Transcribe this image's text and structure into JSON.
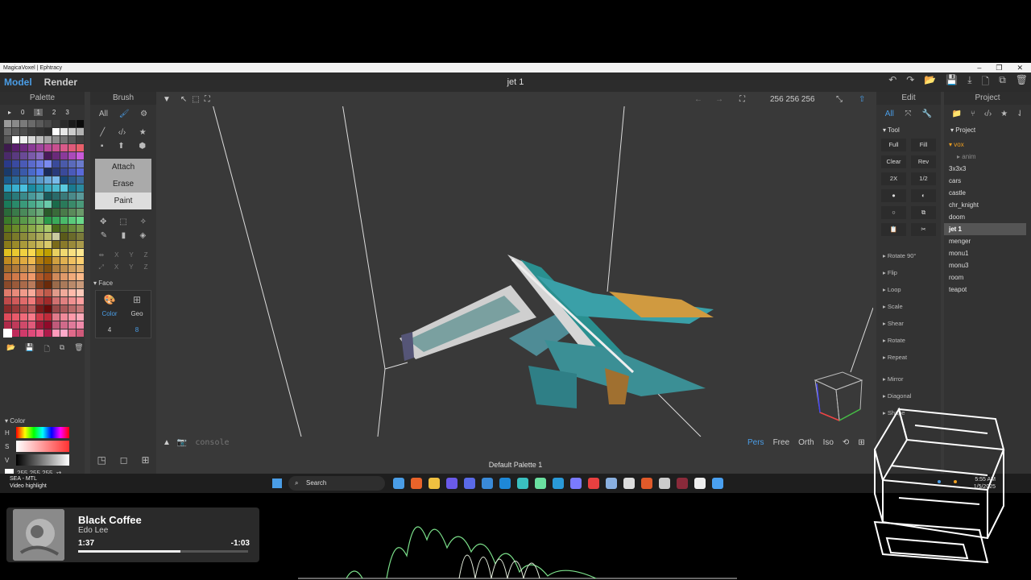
{
  "window": {
    "title": "MagicaVoxel | Ephtracy",
    "minimize_glyph": "–",
    "restore_glyph": "❐",
    "close_glyph": "✕"
  },
  "topbar": {
    "model_tab": "Model",
    "render_tab": "Render",
    "document_title": "jet 1",
    "actions": [
      "↶",
      "↷",
      "📂",
      "💾",
      "⤓",
      "🗋",
      "⧉",
      "🗑"
    ]
  },
  "palette": {
    "header": "Palette",
    "tabs": [
      "▸",
      "0",
      "1",
      "2",
      "3"
    ],
    "selected_tab": "1",
    "colors": [
      "#9a9a9a",
      "#8a8a8a",
      "#7a7a7a",
      "#6a6a6a",
      "#5a5a5a",
      "#4a4a4a",
      "#3a3a3a",
      "#2a2a2a",
      "#1a1a1a",
      "#0a0a0a",
      "#6a6a6a",
      "#5a5a5a",
      "#4c4c4c",
      "#3c3c3c",
      "#333333",
      "#2b2b2b",
      "#ffffff",
      "#e6e6e6",
      "#cccccc",
      "#b3b3b3",
      "#555555",
      "#ffffff",
      "#f0f0f0",
      "#d9d9d9",
      "#bfbfbf",
      "#a6a6a6",
      "#8c8c8c",
      "#737373",
      "#595959",
      "#404040",
      "#3d1a4d",
      "#5a1f6e",
      "#6e2a80",
      "#8a3a96",
      "#a0459e",
      "#b84a9a",
      "#c85090",
      "#d85a8a",
      "#e05a7a",
      "#e8606a",
      "#4a2a6a",
      "#5a3a80",
      "#6a4a96",
      "#7a5aaa",
      "#8a6abf",
      "#4a1a5a",
      "#6a2a7a",
      "#8a3a9a",
      "#aa4aba",
      "#ca5ada",
      "#2a3a8a",
      "#3a4aa0",
      "#4a5ab6",
      "#5a6acc",
      "#6a7ae0",
      "#7a8af0",
      "#3a4a9a",
      "#4a5aaa",
      "#5a6abb",
      "#6a7acc",
      "#1a3a6a",
      "#2a4a8a",
      "#3a5aaa",
      "#4a6aca",
      "#5a7aea",
      "#1a2a5a",
      "#2a3a7a",
      "#3a4a9a",
      "#4a5aba",
      "#5a6ada",
      "#1a5a8a",
      "#2a6a9a",
      "#3a7aaa",
      "#4a8aba",
      "#5a9aca",
      "#6aaada",
      "#7abaea",
      "#1a4a7a",
      "#2a5a8a",
      "#3a6a9a",
      "#2aa0c0",
      "#3ab0d0",
      "#4ac0e0",
      "#1a8aa0",
      "#2a9ab0",
      "#3aaac0",
      "#4abad0",
      "#5acae0",
      "#1a7a90",
      "#2a8aa0",
      "#1a6a6a",
      "#2a7a7a",
      "#3a8a8a",
      "#4a9a9a",
      "#5aaaaa",
      "#1a5a5a",
      "#2a6a6a",
      "#3a7a7a",
      "#4a8a8a",
      "#5a9a9a",
      "#1a7a5a",
      "#2a8a6a",
      "#3a9a7a",
      "#4aaa8a",
      "#5aba9a",
      "#6acaaa",
      "#1a6a4a",
      "#2a7a5a",
      "#3a8a6a",
      "#4a9a7a",
      "#2a6a3a",
      "#3a7a4a",
      "#4a8a5a",
      "#5a9a6a",
      "#6aaa7a",
      "#2a5a2a",
      "#3a6a3a",
      "#4a7a4a",
      "#5a8a5a",
      "#6a9a6a",
      "#3a7a2a",
      "#4a8a3a",
      "#5a9a4a",
      "#6aaa5a",
      "#7aba6a",
      "#2a9a4a",
      "#3aaa5a",
      "#4aba6a",
      "#5aca7a",
      "#6ada8a",
      "#5a7a1a",
      "#6a8a2a",
      "#7a9a3a",
      "#8aaa4a",
      "#9aba5a",
      "#aaca6a",
      "#4a6a1a",
      "#5a7a2a",
      "#6a8a3a",
      "#7a9a4a",
      "#6a6a1a",
      "#7a7a2a",
      "#8a8a3a",
      "#9a9a4a",
      "#aaaa5a",
      "#baba6a",
      "#cacaa0",
      "#5a5a1a",
      "#6a6a2a",
      "#7a7a3a",
      "#8a7a1a",
      "#9a8a2a",
      "#aa9a3a",
      "#baaa4a",
      "#caba5a",
      "#daca6a",
      "#7a6a1a",
      "#8a7a2a",
      "#9a8a3a",
      "#aa9a4a",
      "#e0c020",
      "#e8c830",
      "#f0d040",
      "#f8d850",
      "#d0b010",
      "#c0a000",
      "#e8d060",
      "#f0d870",
      "#f8e080",
      "#ffe890",
      "#c08a20",
      "#d09a30",
      "#e0aa40",
      "#f0ba50",
      "#b07a10",
      "#a06a00",
      "#d0a040",
      "#e0b050",
      "#f0c060",
      "#ffd070",
      "#a06a2a",
      "#b07a3a",
      "#c08a4a",
      "#d09a5a",
      "#906020",
      "#805010",
      "#b08040",
      "#c09050",
      "#d0a060",
      "#e0b070",
      "#c06a3a",
      "#d07a4a",
      "#e08a5a",
      "#f09a6a",
      "#b05a2a",
      "#a04a1a",
      "#d08a5a",
      "#e09a6a",
      "#f0aa7a",
      "#ffba8a",
      "#8a4a2a",
      "#9a5a3a",
      "#aa6a4a",
      "#ba7a5a",
      "#7a3a1a",
      "#6a2a0a",
      "#9a6a4a",
      "#aa7a5a",
      "#ba8a6a",
      "#ca9a7a",
      "#e07a6a",
      "#e88a7a",
      "#f09a8a",
      "#f8aa9a",
      "#d06a5a",
      "#c05a4a",
      "#e09a8a",
      "#f0aa9a",
      "#ffbaaa",
      "#ffcaba",
      "#c04a4a",
      "#d05a5a",
      "#e06a6a",
      "#f07a7a",
      "#b03a3a",
      "#a02a2a",
      "#d07070",
      "#e08080",
      "#f09090",
      "#ffa0a0",
      "#8a2a2a",
      "#9a3a3a",
      "#aa4a4a",
      "#ba5a5a",
      "#7a1a1a",
      "#6a0a0a",
      "#9a4a4a",
      "#aa5a5a",
      "#ba6a6a",
      "#ca7a7a",
      "#e04a5a",
      "#e85a6a",
      "#f06a7a",
      "#f87a8a",
      "#d03a4a",
      "#c02a3a",
      "#e07a8a",
      "#f08a9a",
      "#ff9aaa",
      "#ffaaba",
      "#b02a4a",
      "#c03a5a",
      "#d04a6a",
      "#e05a7a",
      "#a01a3a",
      "#900a2a",
      "#c05a7a",
      "#d06a8a",
      "#e07a9a",
      "#f08aaa",
      "#ffffff",
      "#c02a5a",
      "#d03a6a",
      "#e04a7a",
      "#f05a8a",
      "#b01a4a",
      "#ff9aba",
      "#ffaaca",
      "#e06a8a",
      "#d05a7a"
    ],
    "tool_icons": [
      "📂",
      "💾",
      "🗋",
      "⧉",
      "🗑"
    ],
    "color_section_label": "Color",
    "hsv_labels": [
      "H",
      "S",
      "V"
    ],
    "rgb_value": "255 255 255",
    "swap_icon": "⇄"
  },
  "brush": {
    "header": "Brush",
    "row1": [
      "All",
      "🖌",
      "⚙"
    ],
    "row2": [
      "╱",
      "‹/›",
      "★"
    ],
    "row3": [
      "▪",
      "⬆",
      "⬢"
    ],
    "modes": [
      "Attach",
      "Erase",
      "Paint"
    ],
    "row4": [
      "✥",
      "⬚",
      "✧"
    ],
    "row5": [
      "✎",
      "▮",
      "◈"
    ],
    "axis_row1": [
      "⇹",
      "X",
      "Y",
      "Z"
    ],
    "axis_row2": [
      "⤢",
      "X",
      "Y",
      "Z"
    ],
    "face_label": "Face",
    "face_color_label": "Color",
    "face_geo_label": "Geo",
    "face_color_value": "4",
    "face_geo_value": "8",
    "bottom_icons": [
      "◳",
      "◻",
      "⊞",
      "⊞",
      "⬡",
      "⬢"
    ]
  },
  "viewport": {
    "toolbar_left": [
      "▼",
      "↖",
      "⬚",
      "⛶"
    ],
    "toolbar_right": [
      "←",
      "→",
      "⛶"
    ],
    "dimensions": "256  256  256",
    "fit_icon": "⤡",
    "up_icon": "⇧",
    "console_placeholder": "console",
    "views": [
      "Pers",
      "Free",
      "Orth",
      "Iso"
    ],
    "active_view": "Pers",
    "status": "Default Palette 1"
  },
  "edit": {
    "header": "Edit",
    "tabs": [
      "All",
      "⤧",
      "🔧"
    ],
    "tool_label": "Tool",
    "buttons": [
      "Full",
      "Fill",
      "Clear",
      "Rev",
      "2X",
      "1/2"
    ],
    "icons": [
      "●",
      "◐",
      "○",
      "⧉",
      "📋",
      "✂"
    ],
    "items": [
      "Rotate 90°",
      "Flip",
      "Loop",
      "Scale",
      "Shear",
      "Rotate",
      "Repeat",
      "Mirror",
      "Diagonal",
      "Shape"
    ]
  },
  "project": {
    "header": "Project",
    "tab_icons": [
      "📁",
      "⑂",
      "‹/›",
      "★",
      "⇃"
    ],
    "section_label": "Project",
    "folder": "vox",
    "sub": "anim",
    "items": [
      "3x3x3",
      "cars",
      "castle",
      "chr_knight",
      "doom",
      "jet 1",
      "menger",
      "monu1",
      "monu3",
      "room",
      "teapot"
    ],
    "selected": "jet 1"
  },
  "taskbar": {
    "widget_title": "SEA - MTL",
    "widget_sub": "Video highlight",
    "search_label": "Search",
    "time": "5:55 AM",
    "date": "1/5/2025",
    "icon_colors": [
      "#4a9de6",
      "#e8632a",
      "#f0c040",
      "#6a5ae8",
      "#5a6ae8",
      "#3a8ad8",
      "#1e88d8",
      "#3ac0c0",
      "#6ae0a0",
      "#2a9ad8",
      "#7a7aff",
      "#e84040",
      "#8ab0e0",
      "#ddd",
      "#e05a2a",
      "#ccc",
      "#8a2a3a",
      "#eee",
      "#4aa0f0"
    ]
  },
  "media": {
    "title": "Black Coffee",
    "artist": "Edo Lee",
    "current": "1:37",
    "remaining": "-1:03",
    "progress": 0.6
  }
}
